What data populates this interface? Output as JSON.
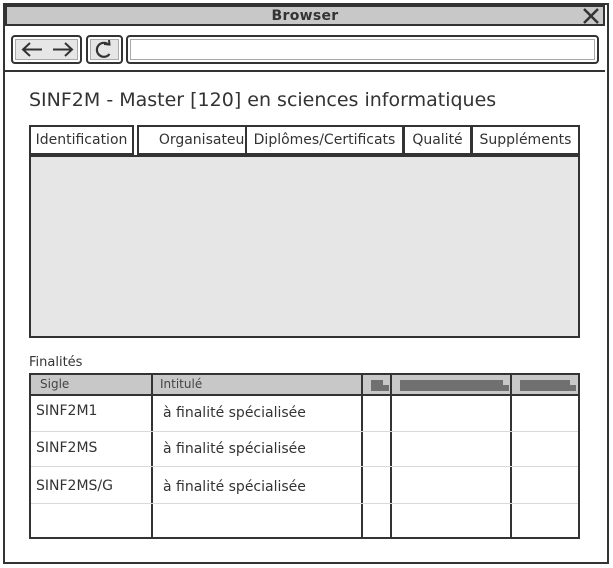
{
  "window": {
    "title": "Browser"
  },
  "address_bar": {
    "value": "",
    "placeholder": ""
  },
  "page": {
    "title": "SINF2M - Master [120] en sciences informatiques"
  },
  "tabs": [
    {
      "label": "Identification",
      "active": true
    },
    {
      "label": "Organisateur",
      "active": false
    },
    {
      "label": "Diplômes/Certificats",
      "active": false
    },
    {
      "label": "Qualité",
      "active": false
    },
    {
      "label": "Suppléments",
      "active": false
    }
  ],
  "finalites": {
    "label": "Finalités",
    "columns": [
      "Sigle",
      "Intitulé",
      "",
      "",
      ""
    ],
    "rows": [
      {
        "sigle": "SINF2M1",
        "intitule": "à finalité spécialisée"
      },
      {
        "sigle": "SINF2MS",
        "intitule": "à finalité spécialisée"
      },
      {
        "sigle": "SINF2MS/G",
        "intitule": "à finalité spécialisée"
      },
      {
        "sigle": "",
        "intitule": ""
      }
    ]
  },
  "icons": {
    "close": "close-icon",
    "back": "arrow-left-icon",
    "forward": "arrow-right-icon",
    "reload": "reload-icon"
  },
  "colors": {
    "chrome": "#c8c8c8",
    "panel": "#e6e6e6",
    "border": "#333333",
    "header_bar": "#707070"
  }
}
